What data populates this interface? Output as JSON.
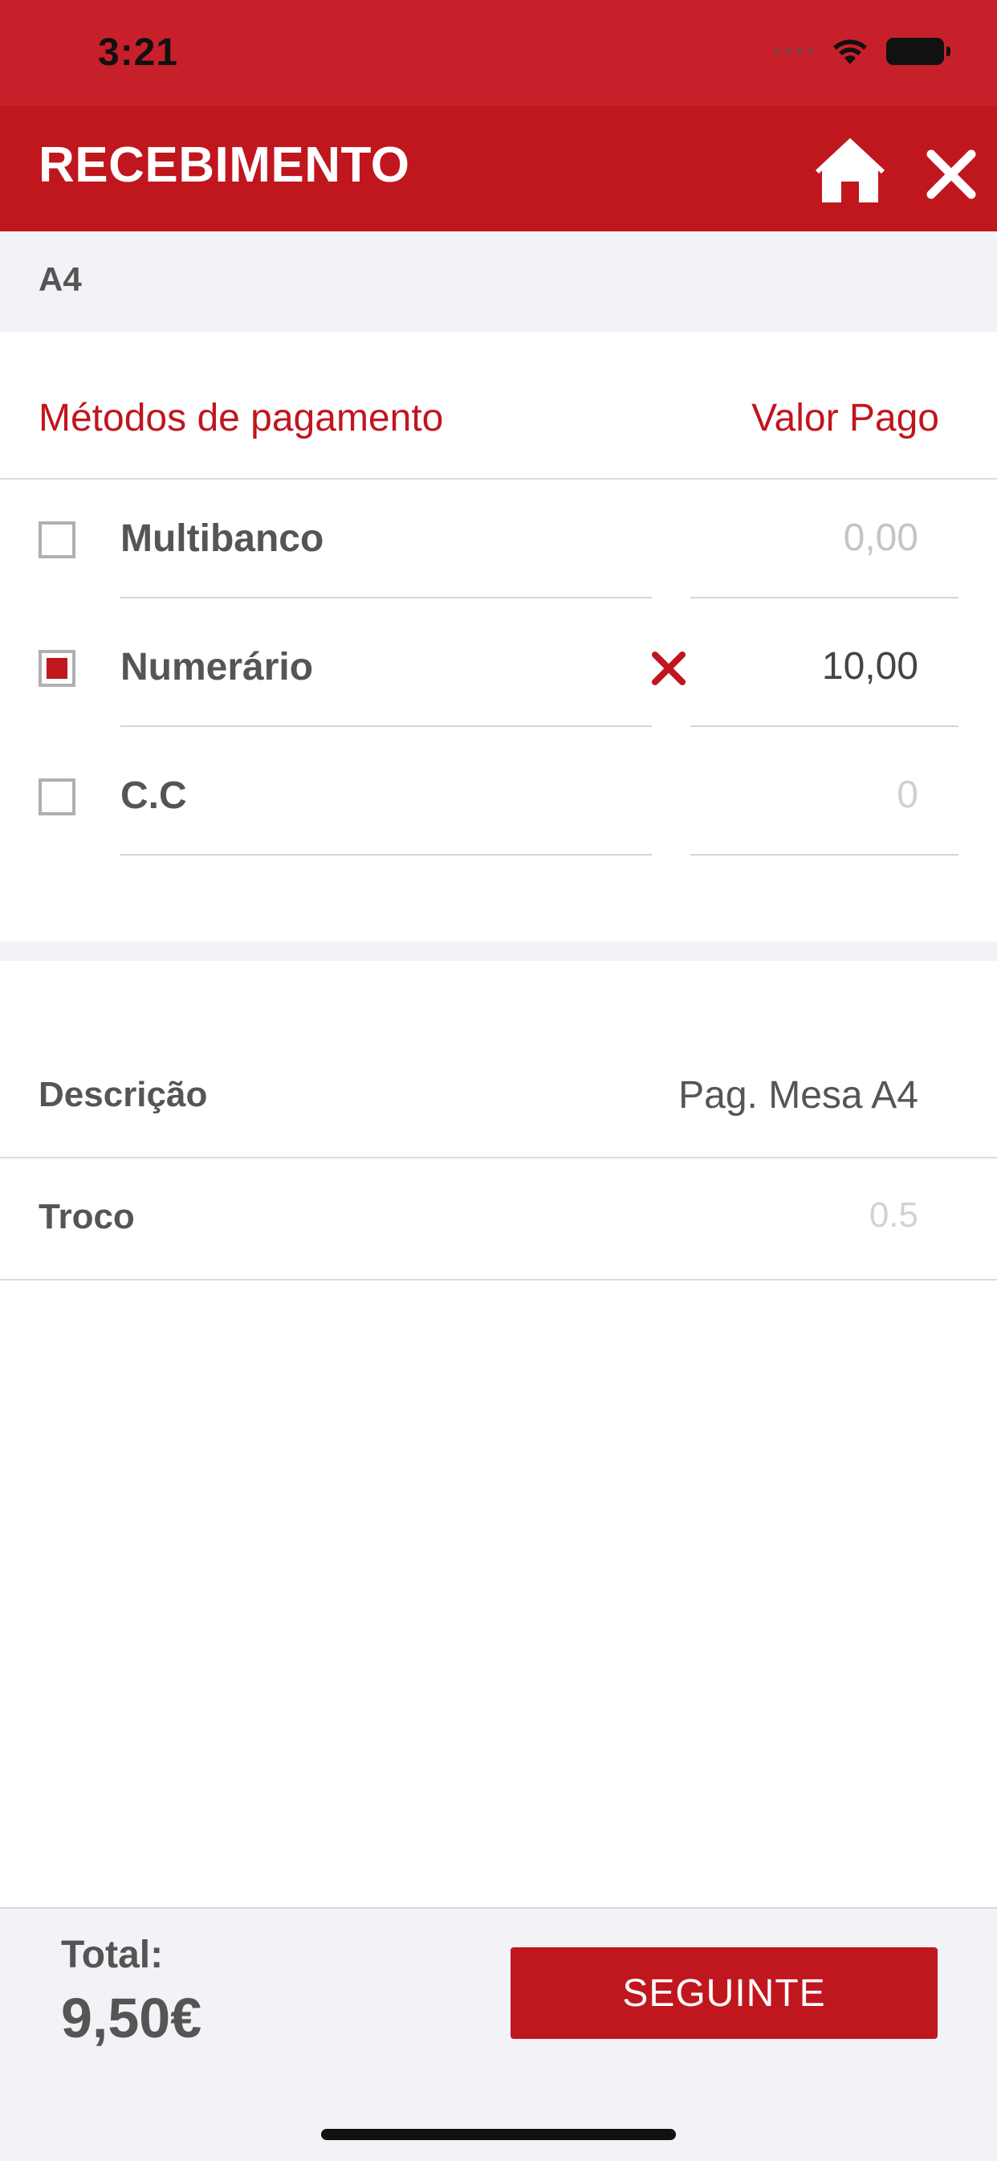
{
  "status_bar": {
    "time": "3:21"
  },
  "nav": {
    "title": "RECEBIMENTO"
  },
  "table_ref": "A4",
  "payment_section": {
    "methods_header": "Métodos de pagamento",
    "value_header": "Valor Pago",
    "methods": [
      {
        "label": "Multibanco",
        "checked": false,
        "value": "",
        "placeholder": "0,00"
      },
      {
        "label": "Numerário",
        "checked": true,
        "value": "10,00",
        "placeholder": ""
      },
      {
        "label": "C.C",
        "checked": false,
        "value": "",
        "placeholder": "0"
      }
    ]
  },
  "details": {
    "description_label": "Descrição",
    "description_value": "Pag. Mesa A4",
    "change_label": "Troco",
    "change_value": "0.5"
  },
  "footer": {
    "total_label": "Total:",
    "total_value": "9,50€",
    "next_label": "SEGUINTE"
  },
  "colors": {
    "brand_red": "#c0161e",
    "status_red": "#c8202a",
    "text_gray": "#555555",
    "background_gray": "#f2f2f7"
  },
  "icons": [
    "wifi-icon",
    "battery-icon",
    "home-icon",
    "close-icon",
    "clear-icon"
  ]
}
